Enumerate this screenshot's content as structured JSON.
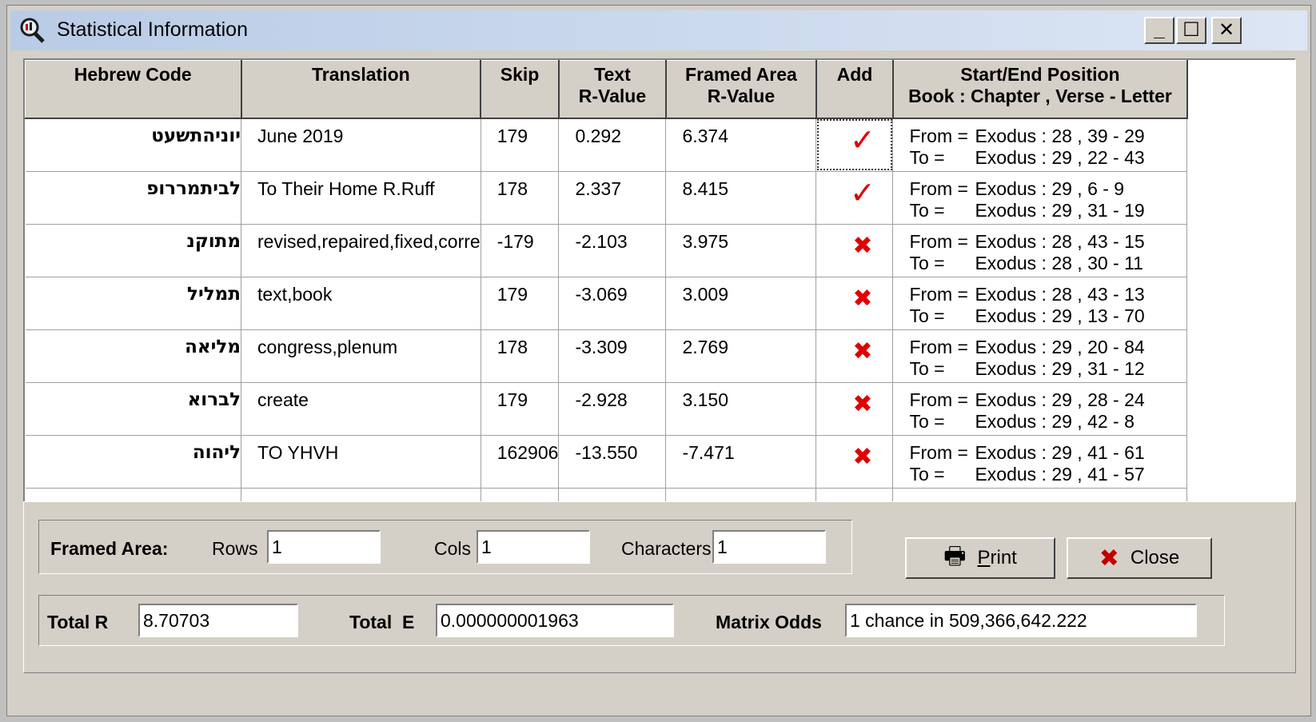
{
  "window": {
    "title": "Statistical Information",
    "minimize": "_",
    "maximize": "☐",
    "close": "✕"
  },
  "grid": {
    "headers": [
      [
        "Hebrew Code",
        ""
      ],
      [
        "Translation",
        ""
      ],
      [
        "Skip",
        ""
      ],
      [
        "Text",
        "R-Value"
      ],
      [
        "Framed Area",
        "R-Value"
      ],
      [
        "Add",
        ""
      ],
      [
        "Start/End Position",
        "Book : Chapter , Verse - Letter"
      ]
    ],
    "rows": [
      {
        "hebrew": "יוניהתשעט",
        "translation": "June 2019",
        "skip": "179",
        "text_r": "0.292",
        "framed_r": "6.374",
        "add": true,
        "from": "Exodus : 28 , 39 - 29",
        "to": "Exodus : 29 , 22 - 43"
      },
      {
        "hebrew": "לביתמררופ",
        "translation": "To Their Home R.Ruff",
        "skip": "178",
        "text_r": "2.337",
        "framed_r": "8.415",
        "add": true,
        "from": "Exodus : 29 , 6 - 9",
        "to": "Exodus : 29 , 31 - 19"
      },
      {
        "hebrew": "מתוקנ",
        "translation": "revised,repaired,fixed,corre",
        "skip": "-179",
        "text_r": "-2.103",
        "framed_r": "3.975",
        "add": false,
        "from": "Exodus : 28 , 43 - 15",
        "to": "Exodus : 28 , 30 - 11"
      },
      {
        "hebrew": "תמליל",
        "translation": "text,book",
        "skip": "179",
        "text_r": "-3.069",
        "framed_r": "3.009",
        "add": false,
        "from": "Exodus : 28 , 43 - 13",
        "to": "Exodus : 29 , 13 - 70"
      },
      {
        "hebrew": "מליאה",
        "translation": "congress,plenum",
        "skip": "178",
        "text_r": "-3.309",
        "framed_r": "2.769",
        "add": false,
        "from": "Exodus : 29 , 20 - 84",
        "to": "Exodus : 29 , 31 - 12"
      },
      {
        "hebrew": "לברוא",
        "translation": "create",
        "skip": "179",
        "text_r": "-2.928",
        "framed_r": "3.150",
        "add": false,
        "from": "Exodus : 29 , 28 - 24",
        "to": "Exodus : 29 , 42 - 8"
      },
      {
        "hebrew": "ליהוה",
        "translation": "TO YHVH",
        "skip": "162906",
        "text_r": "-13.550",
        "framed_r": "-7.471",
        "add": false,
        "from": "Exodus : 29 , 41 - 61",
        "to": "Exodus : 29 , 41 - 57"
      }
    ],
    "from_label": "From =",
    "to_label": "To =",
    "check_glyph": "✓",
    "cross_glyph": "✖"
  },
  "framed_area": {
    "label": "Framed Area:",
    "rows_label": "Rows",
    "rows_value": "1",
    "cols_label": "Cols",
    "cols_value": "1",
    "chars_label": "Characters",
    "chars_value": "1"
  },
  "buttons": {
    "print_first": "P",
    "print_rest": "rint",
    "close": "Close"
  },
  "totals": {
    "total_r_label": "Total R",
    "total_r_value": "8.70703",
    "total_e_label": "Total  E",
    "total_e_value": "0.000000001963",
    "odds_label": "Matrix Odds",
    "odds_value": "1 chance in 509,366,642.222"
  },
  "colors": {
    "mark": "#e00000",
    "titlebar_start": "#b9cbe6",
    "titlebar_end": "#dce6f4"
  }
}
